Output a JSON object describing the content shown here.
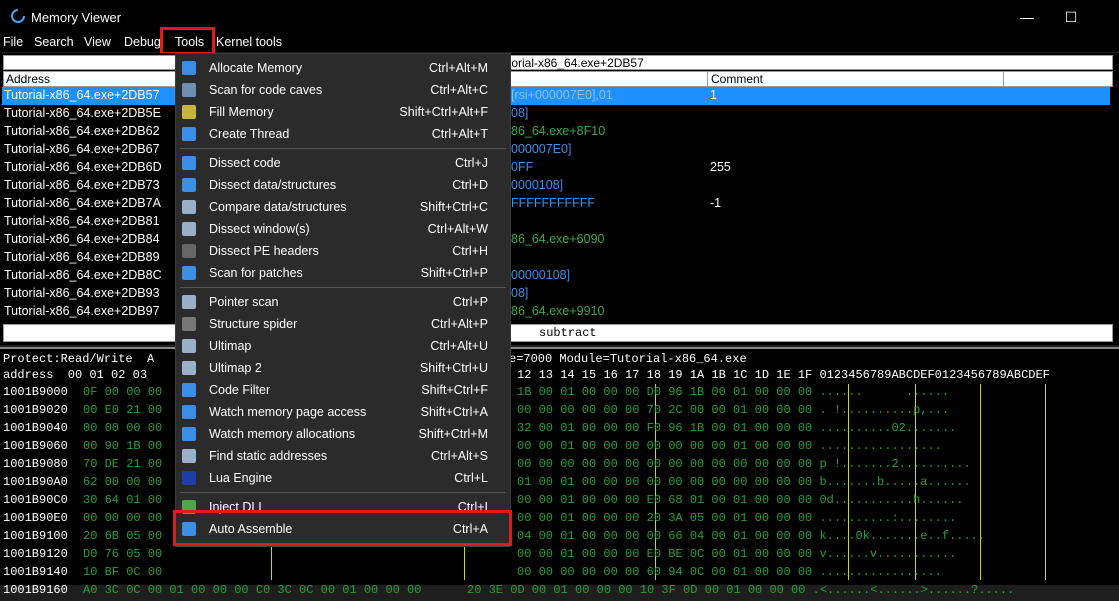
{
  "window": {
    "title": "Memory Viewer"
  },
  "menubar": {
    "items": [
      "File",
      "Search",
      "View",
      "Debug",
      "Tools",
      "Kernel tools"
    ]
  },
  "disasm": {
    "header_addr": "Address",
    "header_comment": "Comment",
    "top_info": "torial-x86_64.exe+2DB57",
    "rows": [
      {
        "addr": "Tutorial-x86_64.exe+2DB57",
        "ins": "[rsi+000007E0],01",
        "comment": "1"
      },
      {
        "addr": "Tutorial-x86_64.exe+2DB5E",
        "ins": "08]",
        "comment": ""
      },
      {
        "addr": "Tutorial-x86_64.exe+2DB62",
        "ins": "86_64.exe+8F10",
        "comment": ""
      },
      {
        "addr": "Tutorial-x86_64.exe+2DB67",
        "ins": "000007E0]",
        "comment": ""
      },
      {
        "addr": "Tutorial-x86_64.exe+2DB6D",
        "ins": "0FF",
        "comment": "255"
      },
      {
        "addr": "Tutorial-x86_64.exe+2DB73",
        "ins": "0000108]",
        "comment": ""
      },
      {
        "addr": "Tutorial-x86_64.exe+2DB7A",
        "ins": "FFFFFFFFFFF",
        "comment": "-1"
      },
      {
        "addr": "Tutorial-x86_64.exe+2DB81",
        "ins": "",
        "comment": ""
      },
      {
        "addr": "Tutorial-x86_64.exe+2DB84",
        "ins": "86_64.exe+6090",
        "comment": ""
      },
      {
        "addr": "Tutorial-x86_64.exe+2DB89",
        "ins": "",
        "comment": ""
      },
      {
        "addr": "Tutorial-x86_64.exe+2DB8C",
        "ins": "00000108]",
        "comment": ""
      },
      {
        "addr": "Tutorial-x86_64.exe+2DB93",
        "ins": "08]",
        "comment": ""
      },
      {
        "addr": "Tutorial-x86_64.exe+2DB97",
        "ins": "86_64.exe+9910",
        "comment": ""
      }
    ],
    "status": "subtract"
  },
  "hex": {
    "info_left": "Protect:Read/Write  A",
    "info_right": "e=7000 Module=Tutorial-x86_64.exe",
    "header_left": "address  00 01 02 03",
    "header_right": "12 13 14 15 16 17 18 19 1A 1B 1C 1D 1E 1F 0123456789ABCDEF0123456789ABCDEF",
    "rows": [
      {
        "addr": "1001B9000",
        "left": "0F 00 00 00",
        "right": "1B 00 01 00 00 00 D0 96 1B 00 01 00 00 00 ......      ......"
      },
      {
        "addr": "1001B9020",
        "left": "00 E0 21 00",
        "right": "00 00 00 00 00 00 70 2C 00 00 01 00 00 00 . !..........p,..."
      },
      {
        "addr": "1001B9040",
        "left": "00 00 00 00",
        "right": "32 00 01 00 00 00 F0 96 1B 00 01 00 00 00 ..........02......."
      },
      {
        "addr": "1001B9060",
        "left": "00 90 1B 00",
        "right": "00 00 01 00 00 00 00 00 00 00 01 00 00 00 ................."
      },
      {
        "addr": "1001B9080",
        "left": "70 DE 21 00",
        "right": "00 00 00 00 00 00 00 00 00 00 00 00 00 00 p !.......2.........."
      },
      {
        "addr": "1001B90A0",
        "left": "62 00 00 00",
        "right": "01 00 01 00 00 00 00 00 00 00 00 00 00 00 b.......b.....a......"
      },
      {
        "addr": "1001B90C0",
        "left": "30 64 01 00",
        "right": "00 00 01 00 00 00 E0 68 01 00 01 00 00 00 0d...........h......"
      },
      {
        "addr": "1001B90E0",
        "left": "00 00 00 00",
        "right": "00 00 01 00 00 00 20 3A 05 00 01 00 00 00 ..........:........"
      },
      {
        "addr": "1001B9100",
        "left": "20 6B 05 00",
        "right": "04 00 01 00 00 00 00 66 04 00 01 00 00 00 k....0k.......e..f....."
      },
      {
        "addr": "1001B9120",
        "left": "D0 76 05 00",
        "right": "00 00 01 00 00 00 E0 BE 0C 00 01 00 00 00 v......v..........."
      },
      {
        "addr": "1001B9140",
        "left": "10 BF 0C 00",
        "right": "00 00 00 00 00 00 60 94 0C 00 01 00 00 00 ................."
      },
      {
        "addr": "1001B9160",
        "left": "A0 3C 0C 00 01 00 00 00 C0 3C 0C 00 01 00 00 00",
        "right": "20 3E 0D 00 01 00 00 00 10 3F 0D 00 01 00 00 00 .<......<......>......?....."
      }
    ]
  },
  "tools_menu": {
    "items": [
      {
        "label": "Allocate Memory",
        "shortcut": "Ctrl+Alt+M",
        "icon": "plus-icon",
        "color": "#3d8ee6"
      },
      {
        "label": "Scan for code caves",
        "shortcut": "Ctrl+Alt+C",
        "icon": "code-cave-icon",
        "color": "#6d8fb0"
      },
      {
        "label": "Fill Memory",
        "shortcut": "Shift+Ctrl+Alt+F",
        "icon": "fill-brush-icon",
        "color": "#c9b440"
      },
      {
        "label": "Create Thread",
        "shortcut": "Ctrl+Alt+T",
        "icon": "thread-icon",
        "color": "#3d8ee6"
      },
      {
        "sep": true
      },
      {
        "label": "Dissect code",
        "shortcut": "Ctrl+J",
        "icon": "code-brackets-icon",
        "color": "#3d8ee6"
      },
      {
        "label": "Dissect data/structures",
        "shortcut": "Ctrl+D",
        "icon": "structure-tree-icon",
        "color": "#3d8ee6"
      },
      {
        "label": "Compare data/structures",
        "shortcut": "Shift+Ctrl+C",
        "icon": "compare-icon",
        "color": "#9ab0c8"
      },
      {
        "label": "Dissect window(s)",
        "shortcut": "Ctrl+Alt+W",
        "icon": "window-search-icon",
        "color": "#9ab0c8"
      },
      {
        "label": "Dissect PE headers",
        "shortcut": "Ctrl+H",
        "icon": "pe-header-icon",
        "color": "#666"
      },
      {
        "label": "Scan for patches",
        "shortcut": "Shift+Ctrl+P",
        "icon": "patch-scan-icon",
        "color": "#3d8ee6"
      },
      {
        "sep": true
      },
      {
        "label": "Pointer scan",
        "shortcut": "Ctrl+P",
        "icon": "pointer-scan-icon",
        "color": "#9ab0c8"
      },
      {
        "label": "Structure spider",
        "shortcut": "Ctrl+Alt+P",
        "icon": "spider-icon",
        "color": "#777"
      },
      {
        "label": "Ultimap",
        "shortcut": "Ctrl+Alt+U",
        "icon": "ultimap-icon",
        "color": "#9ab0c8"
      },
      {
        "label": "Ultimap 2",
        "shortcut": "Shift+Ctrl+U",
        "icon": "ultimap2-icon",
        "color": "#9ab0c8"
      },
      {
        "label": "Code Filter",
        "shortcut": "Shift+Ctrl+F",
        "icon": "filter-icon",
        "color": "#3d8ee6"
      },
      {
        "label": "Watch memory page access",
        "shortcut": "Shift+Ctrl+A",
        "icon": "eye-icon",
        "color": "#3d8ee6"
      },
      {
        "label": "Watch memory allocations",
        "shortcut": "Shift+Ctrl+M",
        "icon": "eye-icon",
        "color": "#3d8ee6"
      },
      {
        "label": "Find static addresses",
        "shortcut": "Ctrl+Alt+S",
        "icon": "magnifier-icon",
        "color": "#9ab0c8"
      },
      {
        "label": "Lua Engine",
        "shortcut": "Ctrl+L",
        "icon": "lua-icon",
        "color": "#1f3fa8"
      },
      {
        "sep": true
      },
      {
        "label": "Inject DLL",
        "shortcut": "Ctrl+I",
        "icon": "syringe-icon",
        "color": "#4aa84a"
      },
      {
        "label": "Auto Assemble",
        "shortcut": "Ctrl+A",
        "icon": "auto-assemble-icon",
        "color": "#3d8ee6"
      }
    ]
  },
  "colors": {
    "highlight": "#e11b1b",
    "selection": "#1e90ff",
    "hex_green": "#2a9d3a",
    "separator": "#d6d600"
  }
}
